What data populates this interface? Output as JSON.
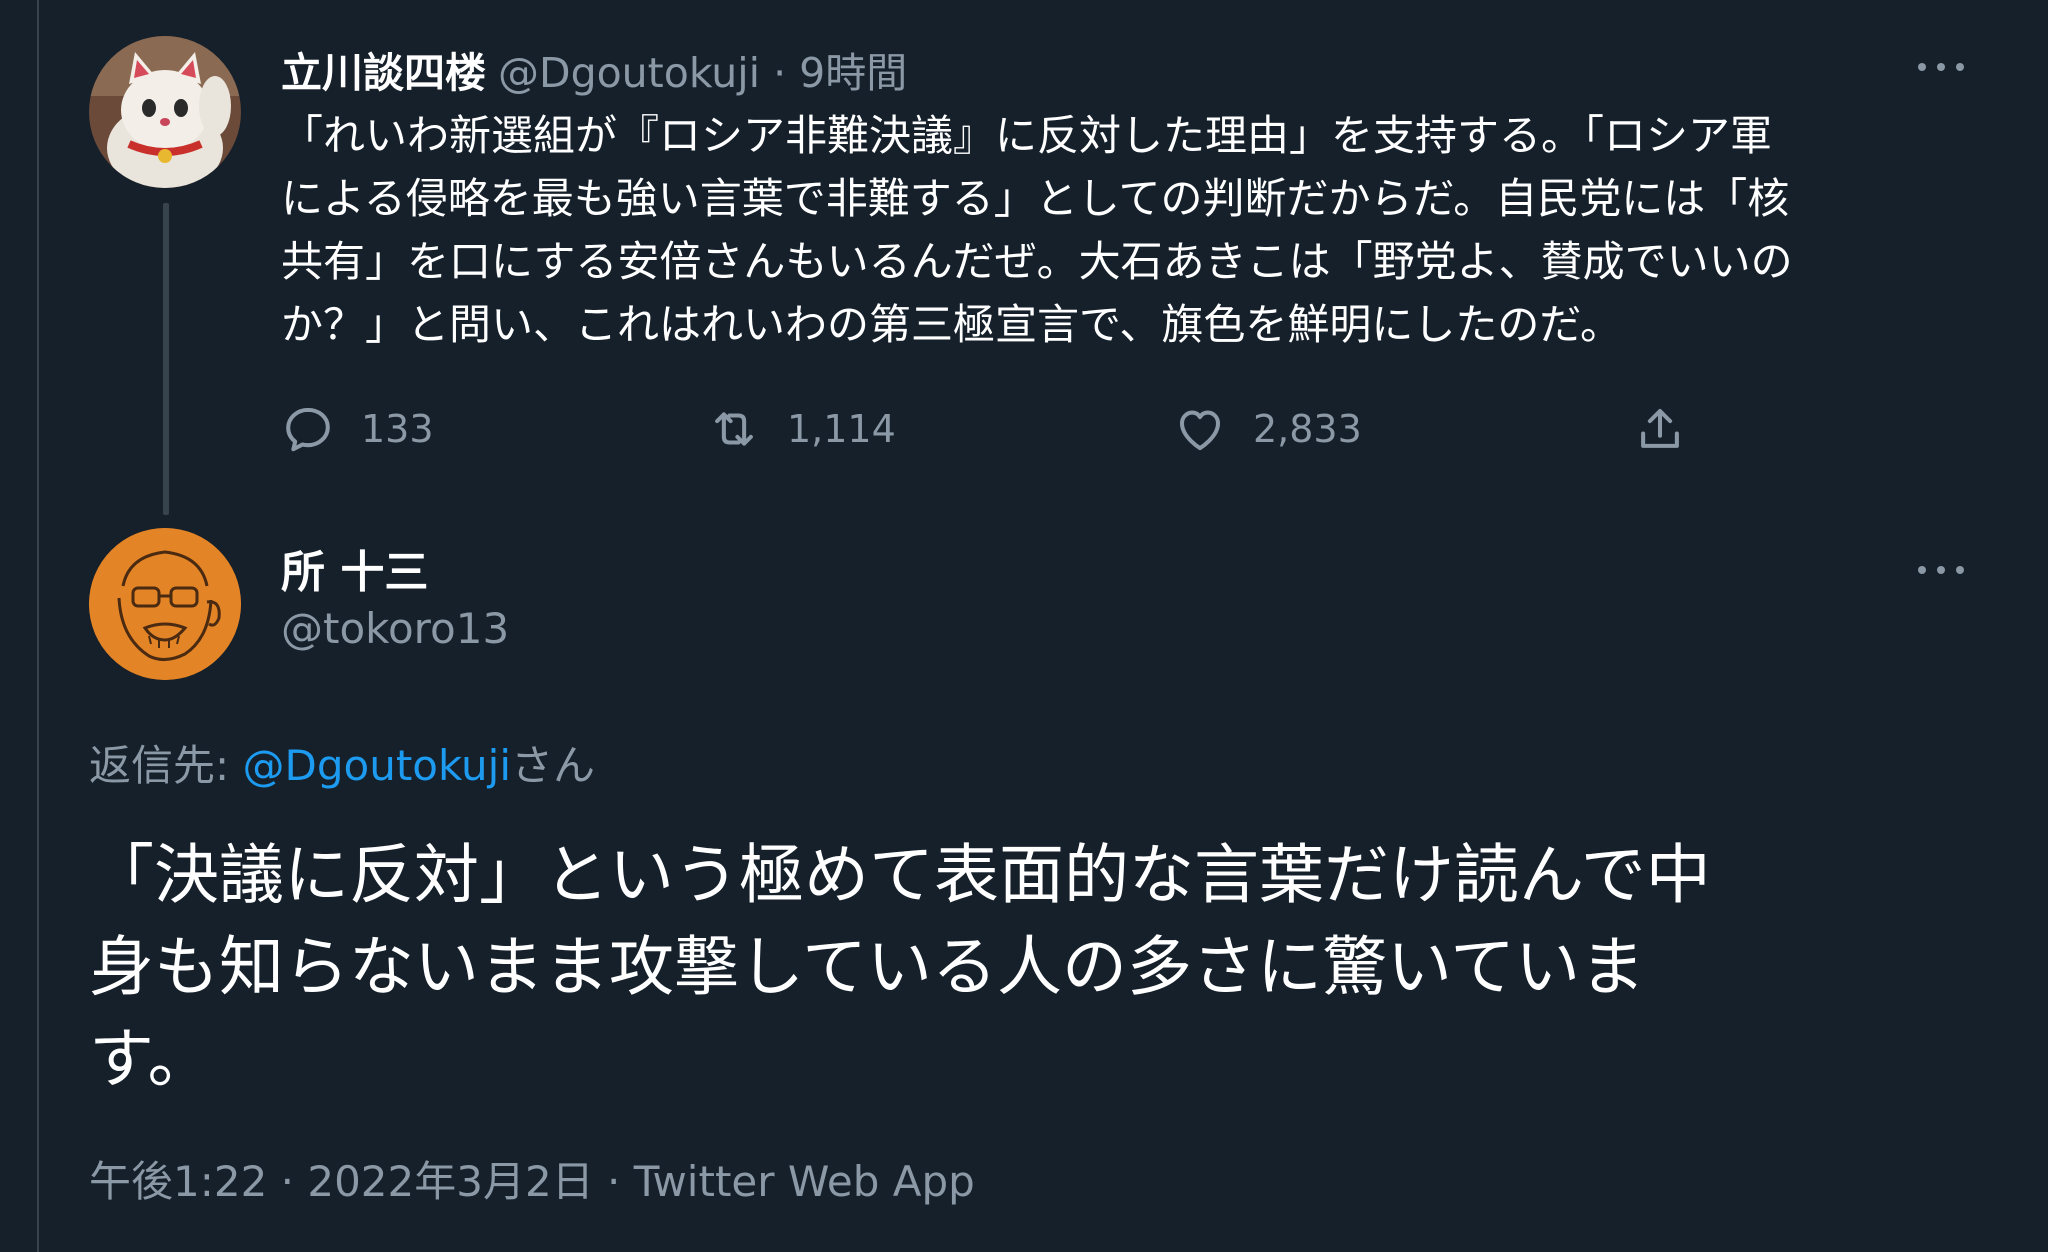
{
  "parent_tweet": {
    "display_name": "立川談四楼",
    "meta": "@Dgoutokuji · 9時間",
    "avatar_icon": "maneki-neko-avatar",
    "text_lines": [
      "「れいわ新選組が『ロシア非難決議』に反対した理由」を支持する。「ロシア軍",
      "による侵略を最も強い言葉で非難する」としての判断だからだ。自民党には「核",
      "共有」を口にする安倍さんもいるんだぜ。大石あきこは「野党よ、賛成でいいの",
      "か？」と問い、これはれいわの第三極宣言で、旗色を鮮明にしたのだ。"
    ],
    "actions": {
      "reply_count": "133",
      "retweet_count": "1,114",
      "like_count": "2,833"
    },
    "icons": [
      "more-icon",
      "reply-icon",
      "retweet-icon",
      "like-icon",
      "share-icon"
    ]
  },
  "main_tweet": {
    "display_name": "所 十三",
    "handle": "@tokoro13",
    "avatar_icon": "sketch-portrait-avatar",
    "reply_to": {
      "prefix": "返信先: ",
      "mention": "@Dgoutokuji",
      "suffix": "さん"
    },
    "text_lines": [
      "「決議に反対」という極めて表面的な言葉だけ読んで中",
      "身も知らないまま攻撃している人の多さに驚いていま",
      "す。"
    ],
    "meta": "午後1:22 · 2022年3月2日 · Twitter Web App"
  },
  "colors": {
    "background": "#15202b",
    "text_primary": "#ffffff",
    "text_secondary": "#8b98a5",
    "accent": "#1d9bf0",
    "divider": "#38444d"
  }
}
